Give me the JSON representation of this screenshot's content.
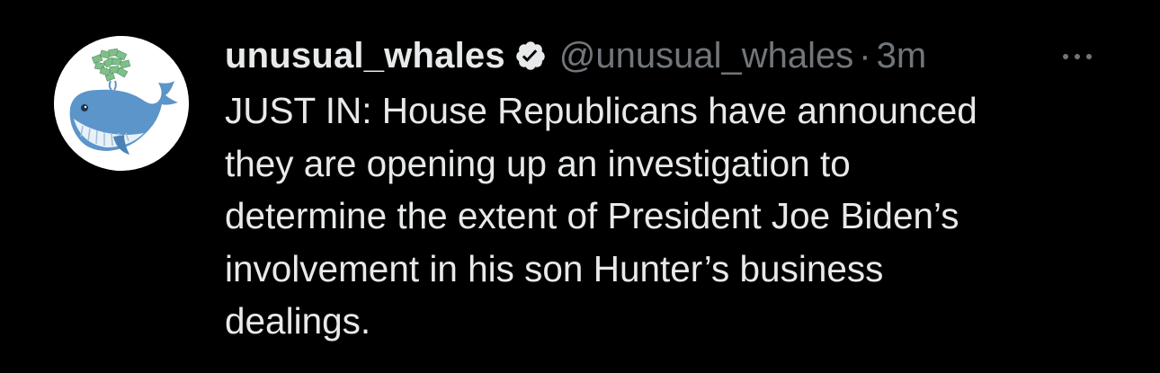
{
  "tweet": {
    "display_name": "unusual_whales",
    "verified_icon": "verified-badge-icon",
    "handle": "@unusual_whales",
    "separator": "·",
    "timestamp": "3m",
    "more_icon": "more-dots-icon",
    "avatar_icon": "whale-logo-icon",
    "text_lines": [
      "JUST IN: House Republicans have announced",
      "they are opening up an investigation to",
      "determine the extent of President Joe Biden’s",
      "involvement in his son Hunter’s business",
      "dealings."
    ]
  },
  "colors": {
    "background": "#000000",
    "primary_text": "#e7e9ea",
    "secondary_text": "#71767b",
    "whale_blue": "#5b95c9",
    "money_green": "#7fbf8a"
  }
}
